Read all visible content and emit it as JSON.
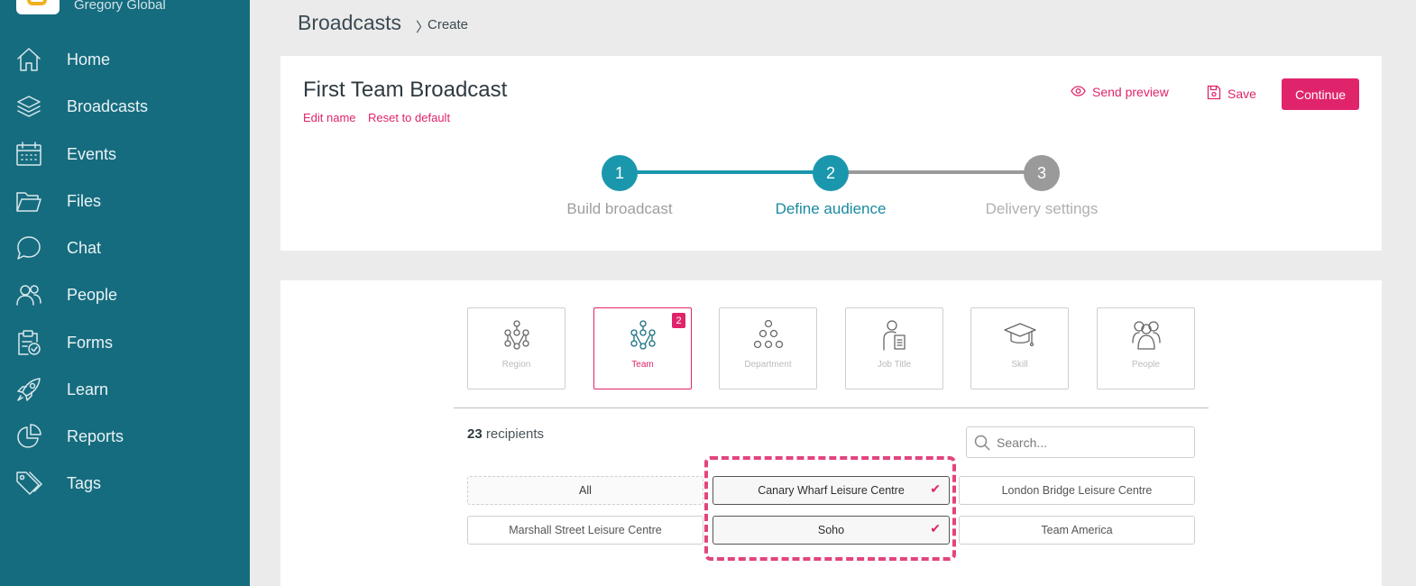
{
  "sidebar": {
    "org_name": "Gregory Global",
    "items": [
      {
        "label": "Home",
        "icon": "home-icon"
      },
      {
        "label": "Broadcasts",
        "icon": "layers-icon"
      },
      {
        "label": "Events",
        "icon": "calendar-icon"
      },
      {
        "label": "Files",
        "icon": "folder-icon"
      },
      {
        "label": "Chat",
        "icon": "chat-bubble-icon"
      },
      {
        "label": "People",
        "icon": "people-icon"
      },
      {
        "label": "Forms",
        "icon": "clipboard-check-icon"
      },
      {
        "label": "Learn",
        "icon": "rocket-icon"
      },
      {
        "label": "Reports",
        "icon": "pie-chart-icon"
      },
      {
        "label": "Tags",
        "icon": "tags-icon"
      }
    ]
  },
  "breadcrumb": {
    "title": "Broadcasts",
    "separator": "〉",
    "current": "Create"
  },
  "broadcast": {
    "title": "First Team Broadcast",
    "edit_name": "Edit name",
    "reset_default": "Reset to default"
  },
  "actions": {
    "send_preview": "Send preview",
    "save": "Save",
    "continue": "Continue"
  },
  "steps": [
    {
      "number": "1",
      "label": "Build broadcast",
      "state": "done"
    },
    {
      "number": "2",
      "label": "Define audience",
      "state": "current"
    },
    {
      "number": "3",
      "label": "Delivery settings",
      "state": "upcoming"
    }
  ],
  "audience_types": [
    {
      "label": "Region",
      "icon": "region-icon",
      "active": false,
      "badge": ""
    },
    {
      "label": "Team",
      "icon": "team-icon",
      "active": true,
      "badge": "2"
    },
    {
      "label": "Department",
      "icon": "department-icon",
      "active": false,
      "badge": ""
    },
    {
      "label": "Job Title",
      "icon": "job-title-icon",
      "active": false,
      "badge": ""
    },
    {
      "label": "Skill",
      "icon": "graduation-cap-icon",
      "active": false,
      "badge": ""
    },
    {
      "label": "People",
      "icon": "people-group-icon",
      "active": false,
      "badge": ""
    }
  ],
  "recipients": {
    "count": "23",
    "label": "recipients"
  },
  "search": {
    "placeholder": "Search..."
  },
  "options": [
    {
      "label": "All",
      "state": "all"
    },
    {
      "label": "Canary Wharf Leisure Centre",
      "state": "selected"
    },
    {
      "label": "London Bridge Leisure Centre",
      "state": "unselected"
    },
    {
      "label": "Marshall Street Leisure Centre",
      "state": "unselected"
    },
    {
      "label": "Soho",
      "state": "selected"
    },
    {
      "label": "Team America",
      "state": "unselected"
    }
  ],
  "check_mark": "✔",
  "colors": {
    "sidebar": "#166c7f",
    "accent": "#e0246b",
    "step_active": "#1b97ad",
    "step_inactive": "#9a9a9a"
  }
}
